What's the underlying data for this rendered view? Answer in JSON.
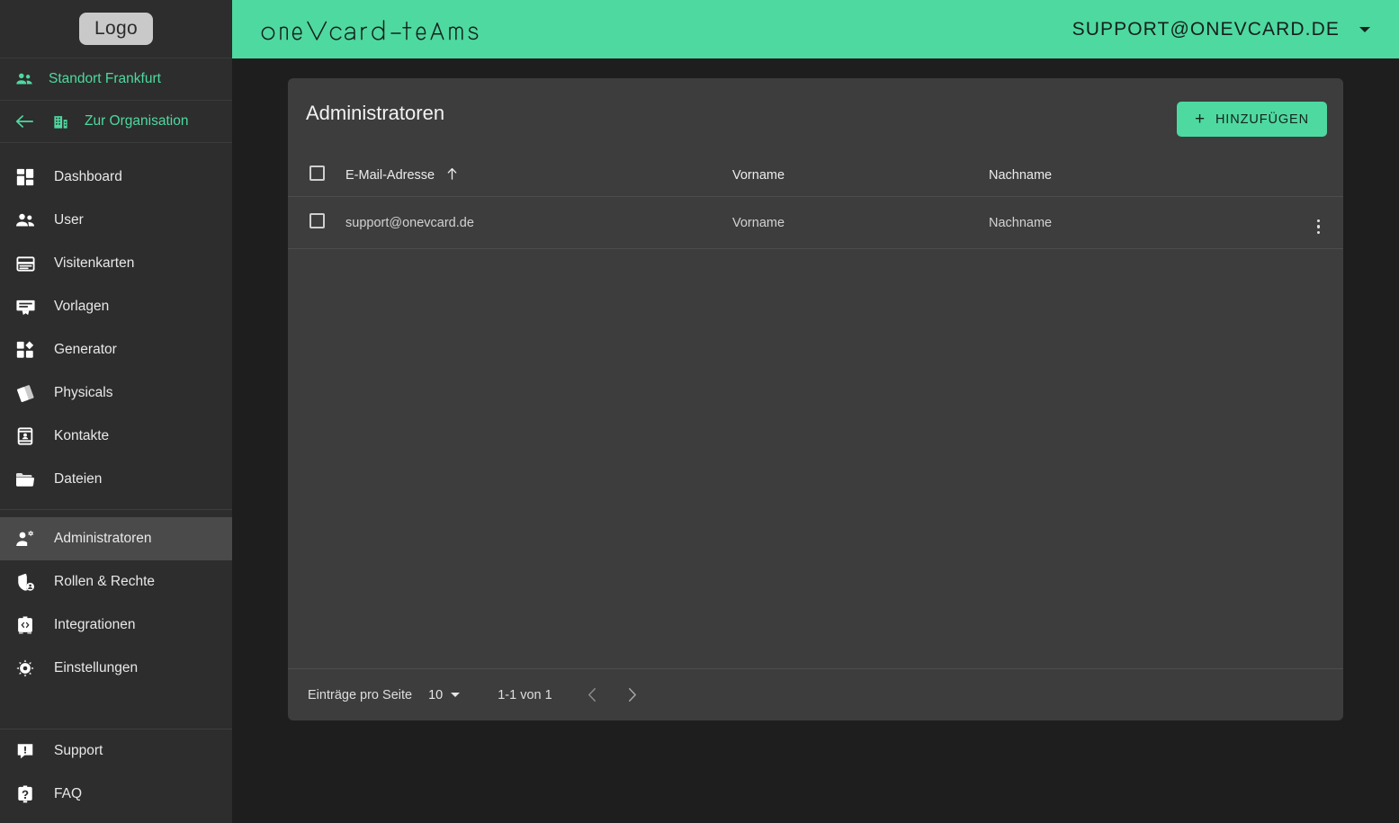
{
  "sidebar": {
    "logo_label": "Logo",
    "location": {
      "label": "Standort Frankfurt",
      "icon": "people-icon"
    },
    "organisation": {
      "label": "Zur Organisation",
      "icon": "building-icon",
      "back_icon": "arrow-left-icon"
    },
    "items": [
      {
        "label": "Dashboard",
        "icon": "dashboard-icon"
      },
      {
        "label": "User",
        "icon": "people-icon"
      },
      {
        "label": "Visitenkarten",
        "icon": "card-icon"
      },
      {
        "label": "Vorlagen",
        "icon": "monitor-icon"
      },
      {
        "label": "Generator",
        "icon": "generator-icon"
      },
      {
        "label": "Physicals",
        "icon": "cards-stack-icon"
      },
      {
        "label": "Kontakte",
        "icon": "contact-icon"
      },
      {
        "label": "Dateien",
        "icon": "folder-icon"
      },
      {
        "label": "Administratoren",
        "icon": "admin-icon",
        "active": true
      },
      {
        "label": "Rollen & Rechte",
        "icon": "shield-user-icon"
      },
      {
        "label": "Integrationen",
        "icon": "code-box-icon"
      },
      {
        "label": "Einstellungen",
        "icon": "gear-icon"
      }
    ],
    "bottom_items": [
      {
        "label": "Support",
        "icon": "support-chat-icon"
      },
      {
        "label": "FAQ",
        "icon": "question-icon"
      }
    ]
  },
  "topbar": {
    "brand": "oneVcard-teams",
    "user_email": "SUPPORT@ONEVCARD.DE",
    "caret_icon": "chevron-down-icon"
  },
  "card": {
    "title": "Administratoren",
    "add_button": {
      "label": "HINZUFÜGEN",
      "icon": "plus-icon"
    },
    "table": {
      "columns": [
        "E-Mail-Adresse",
        "Vorname",
        "Nachname"
      ],
      "sorted_column": "E-Mail-Adresse",
      "sort_direction": "asc",
      "rows": [
        {
          "email": "support@onevcard.de",
          "vorname": "Vorname",
          "nachname": "Nachname"
        }
      ]
    },
    "footer": {
      "per_page_label": "Einträge pro Seite",
      "per_page_value": "10",
      "range": "1-1 von 1",
      "prev_icon": "chevron-left-icon",
      "next_icon": "chevron-right-icon"
    }
  },
  "colors": {
    "accent": "#4ed9a0",
    "page_bg": "#1e1e1e",
    "sidebar_bg": "#2d2d2d",
    "card_bg": "#3d3d3d",
    "active_nav_bg": "#4a4a4a"
  }
}
